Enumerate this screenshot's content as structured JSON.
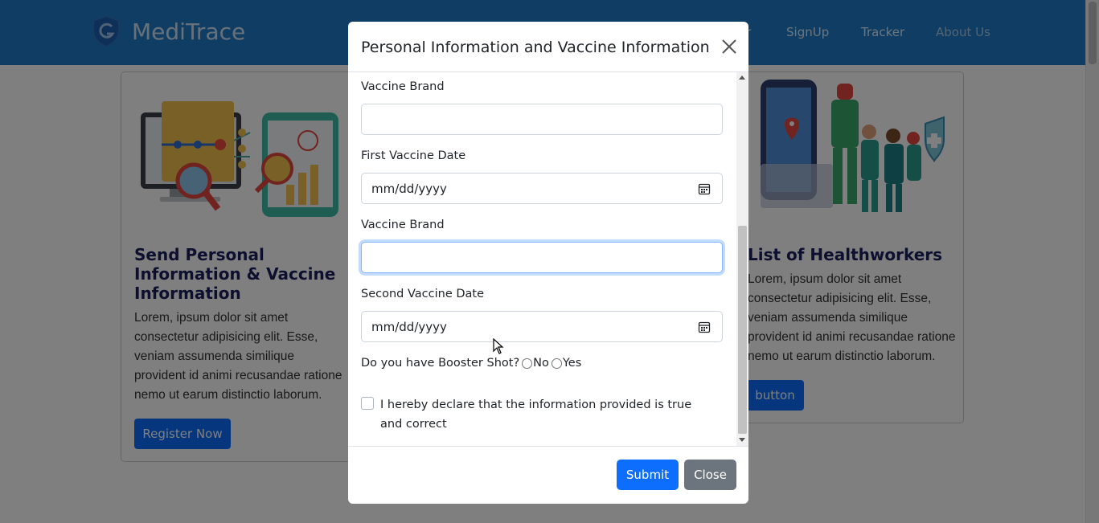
{
  "app": {
    "brand_name": "MediTrace",
    "nav_links": [
      "r",
      "SignUp",
      "Tracker",
      "About Us"
    ]
  },
  "cards": [
    {
      "title": "Send Personal Information & Vaccine Information",
      "text": "Lorem, ipsum dolor sit amet consectetur adipisicing elit. Esse, veniam assumenda similique provident id animi recusandae ratione nemo ut earum distinctio laborum.",
      "button_label": "Register Now"
    },
    {
      "title": "List of Healthworkers",
      "text": "Lorem, ipsum dolor sit amet consectetur adipisicing elit. Esse, veniam assumenda similique provident id animi recusandae ratione nemo ut earum distinctio laborum.",
      "button_label": "button"
    }
  ],
  "modal": {
    "title": "Personal Information and Vaccine Information",
    "fields": [
      {
        "label": "Vaccine Brand",
        "value": ""
      },
      {
        "label": "First Vaccine Date",
        "value": "mm/dd/yyyy"
      },
      {
        "label": "Vaccine Brand",
        "value": ""
      },
      {
        "label": "Second Vaccine Date",
        "value": "mm/dd/yyyy"
      }
    ],
    "booster": {
      "question": "Do you have Booster Shot?",
      "options": [
        "No",
        "Yes"
      ]
    },
    "declaration": "I hereby declare that the information provided is true and correct",
    "submit_label": "Submit",
    "close_label": "Close"
  },
  "colors": {
    "navbar": "#1f7ac7",
    "primary": "#0d6efd",
    "secondary": "#6c757d",
    "card_title": "#1a1f5c"
  }
}
